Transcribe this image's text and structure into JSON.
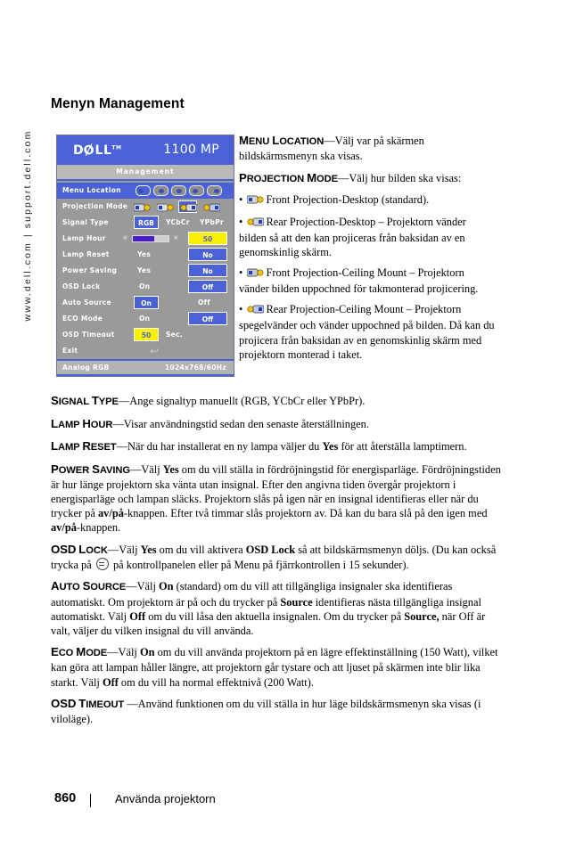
{
  "sidebar": {
    "url_text": "www.dell.com | support.dell.com"
  },
  "page": {
    "title": "Menyn Management",
    "footer_page_number": "860",
    "footer_text": "Använda projektorn"
  },
  "osd": {
    "brand": "D∅LL",
    "brand_tm": "TM",
    "model": "1100 MP",
    "tab": "Management",
    "rows": [
      {
        "label": "Menu Location",
        "type": "menu-location",
        "selected_index": 0
      },
      {
        "label": "Projection Mode",
        "type": "projection-mode",
        "selected_index": 2
      },
      {
        "label": "Signal Type",
        "type": "signal-type",
        "options": [
          "RGB",
          "YCbCr",
          "YPbPr"
        ],
        "selected": "RGB"
      },
      {
        "label": "Lamp Hour",
        "type": "lamp-hour",
        "value": "50"
      },
      {
        "label": "Lamp Reset",
        "type": "yesno",
        "left": "Yes",
        "right": "No",
        "selected": "No"
      },
      {
        "label": "Power Saving",
        "type": "yesno",
        "left": "Yes",
        "right": "No",
        "selected": "No"
      },
      {
        "label": "OSD Lock",
        "type": "onoff",
        "left": "On",
        "right": "Off",
        "selected": "Off"
      },
      {
        "label": "Auto Source",
        "type": "onoff",
        "left": "On",
        "right": "Off",
        "selected": "On"
      },
      {
        "label": "ECO Mode",
        "type": "onoff",
        "left": "On",
        "right": "Off",
        "selected": "Off"
      },
      {
        "label": "OSD Timeout",
        "type": "timeout",
        "value": "50",
        "unit": "Sec."
      },
      {
        "label": "Exit",
        "type": "exit"
      }
    ],
    "footer_left": "Analog RGB",
    "footer_right": "1024x768/60Hz",
    "colors": {
      "accent_blue": "#4a62d6",
      "panel_gray": "#9a9a9a",
      "highlight_yellow": "#fbf000",
      "gauge_purple": "#4b19cf"
    }
  },
  "content": {
    "menu_location": {
      "term": "Menu Location",
      "body": "—Välj var på skärmen bildskärmsmenyn ska visas."
    },
    "projection_mode": {
      "term": "Projection Mode",
      "body": "—Välj hur bilden ska visas:",
      "bullets": [
        {
          "icon": "front-projection-desktop-icon",
          "text": "Front Projection-Desktop (standard)."
        },
        {
          "icon": "rear-projection-desktop-icon",
          "text": "Rear Projection-Desktop – Projektorn vänder bilden så att den kan projiceras från baksidan av en genomskinlig skärm."
        },
        {
          "icon": "front-projection-ceiling-icon",
          "text": "Front Projection-Ceiling Mount – Projektorn vänder bilden uppochned för takmonterad projicering."
        },
        {
          "icon": "rear-projection-ceiling-icon",
          "text": "Rear Projection-Ceiling Mount – Projektorn spegelvänder och vänder uppochned på bilden. Då kan du projicera från baksidan av en genomskinlig skärm med projektorn monterad i taket."
        }
      ]
    },
    "signal_type": {
      "term": "Signal Type",
      "body": "—Ange signaltyp manuellt (RGB, YCbCr eller YPbPr)."
    },
    "lamp_hour": {
      "term": "Lamp Hour",
      "body": "—Visar användningstid sedan den senaste återställningen."
    },
    "lamp_reset": {
      "term": "Lamp Reset",
      "part1": "—När du har installerat en ny lampa väljer du ",
      "bold1": "Yes",
      "part2": " för att återställa lamptimern."
    },
    "power_saving": {
      "term": "Power Saving",
      "part1": "—Välj ",
      "bold1": "Yes",
      "part2": " om du vill ställa in fördröjningstid för energisparläge. Fördröjningstiden är hur länge projektorn ska vänta utan insignal. Efter den angivna tiden övergår projektorn i energisparläge och lampan släcks. Projektorn slås på igen när en insignal identifieras eller när du trycker på ",
      "bold2": "av/på",
      "part3": "-knappen. Efter två timmar slås projektorn av. Då kan du bara slå på den igen med ",
      "bold3": "av/på",
      "part4": "-knappen."
    },
    "osd_lock": {
      "term": "OSD Lock",
      "part1": "—Välj ",
      "bold1": "Yes",
      "part2": " om du vill aktivera ",
      "bold2": "OSD Lock",
      "part3": " så att bildskärmsmenyn döljs. (Du kan också trycka på ",
      "icon": "menu-button-icon",
      "part4": " på kontrollpanelen eller på Menu på fjärrkontrollen i 15 sekunder)."
    },
    "auto_source": {
      "term": "Auto Source",
      "part1": "—Välj ",
      "bold1": "On",
      "part2": " (standard) om du vill att tillgängliga insignaler ska identifieras automatiskt. Om projektorn är på och du trycker på ",
      "bold2": "Source",
      "part3": " identifieras nästa tillgängliga insignal automatiskt. Välj ",
      "bold3": "Off",
      "part4": " om du vill låsa den aktuella insignalen. Om du trycker på ",
      "bold4": "Source,",
      "part5": " när Off är valt, väljer du vilken insignal du vill använda."
    },
    "eco_mode": {
      "term": "Eco Mode",
      "part1": "—Välj ",
      "bold1": "On",
      "part2": " om du vill använda projektorn på en lägre effektinställning (150 Watt), vilket kan göra att lampan håller längre, att projektorn går tystare och att ljuset på skärmen inte blir lika starkt. Välj ",
      "bold2": "Off",
      "part3": " om du vill ha normal effektnivå (200 Watt)."
    },
    "osd_timeout": {
      "term": "OSD Timeout",
      "body": " —Använd funktionen om du vill ställa in hur läge bildskärmsmenyn ska visas (i viloläge)."
    }
  }
}
